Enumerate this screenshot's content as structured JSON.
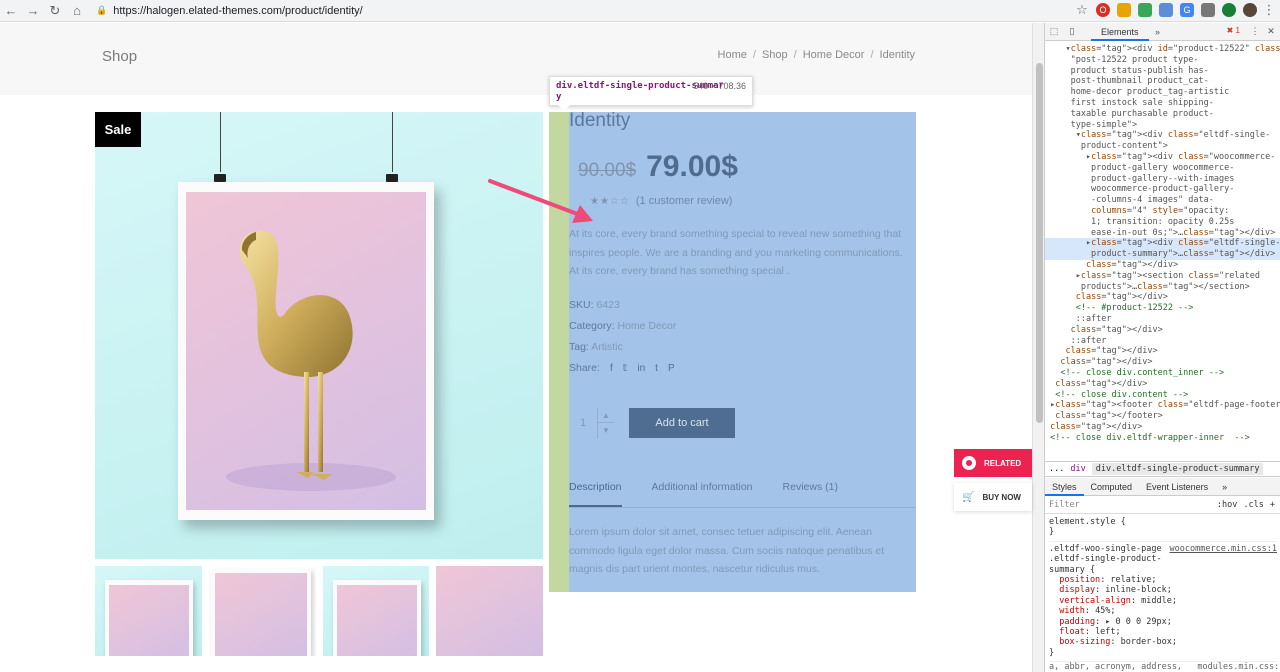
{
  "browser": {
    "url": "https://halogen.elated-themes.com/product/identity/",
    "extensions": [
      {
        "name": "opera-icon",
        "color": "#d93025"
      },
      {
        "name": "ext-yellow-icon",
        "color": "#e8a400"
      },
      {
        "name": "shield-icon",
        "color": "#3aa757"
      },
      {
        "name": "ext-blue-icon",
        "color": "#5b8dd9"
      },
      {
        "name": "translate-icon",
        "color": "#4285f4"
      },
      {
        "name": "camera-icon",
        "color": "#777777"
      },
      {
        "name": "pin-icon",
        "color": "#188038"
      }
    ]
  },
  "page": {
    "shop_title": "Shop",
    "breadcrumbs": [
      "Home",
      "Shop",
      "Home Decor",
      "Identity"
    ],
    "sale_badge": "Sale",
    "tooltip": {
      "selector": "div.eltdf-single-product-summar",
      "selector_wrap": "y",
      "size": "540 × 708.36"
    },
    "product": {
      "title": "Identity",
      "old_price": "90.00$",
      "new_price": "79.00$",
      "rating_text": "(1 customer review)",
      "description": "At its core, every brand something special to reveal new something that inspires people. We are a branding and you marketing communications. At its core, every brand has something special .",
      "sku_label": "SKU:",
      "sku": "6423",
      "category_label": "Category:",
      "category": "Home Decor",
      "tag_label": "Tag:",
      "tag": "Artistic",
      "share_label": "Share:",
      "quantity": "1",
      "add_to_cart": "Add to cart",
      "tabs": [
        "Description",
        "Additional information",
        "Reviews (1)"
      ],
      "tab_content": "Lorem ipsum dolor sit amet, consec tetuer adipiscing elit. Aenean commodo ligula eget dolor massa. Cum sociis natoque penatibus et magnis dis part urient montes, nascetur ridiculus mus."
    },
    "side_buttons": {
      "related": "RELATED",
      "buy_now": "BUY NOW"
    }
  },
  "devtools": {
    "tab": "Elements",
    "error_count": "1",
    "breadcrumbs": [
      "...",
      "div",
      "div.eltdf-single-product-summary"
    ],
    "style_tabs": [
      "Styles",
      "Computed",
      "Event Listeners"
    ],
    "filter_placeholder": "Filter",
    "filter_hov": ":hov",
    "filter_cls": ".cls",
    "element_style": "element.style {",
    "rule_selector_1": ".eltdf-woo-single-page",
    "rule_selector_2": ".eltdf-single-product-",
    "rule_selector_3": "summary {",
    "rule_source": "woocommerce.min.css:1",
    "rule_props": [
      {
        "name": "position",
        "value": "relative;"
      },
      {
        "name": "display",
        "value": "inline-block;"
      },
      {
        "name": "vertical-align",
        "value": "middle;"
      },
      {
        "name": "width",
        "value": "45%;"
      },
      {
        "name": "padding",
        "value": "▸ 0 0 0 29px;"
      },
      {
        "name": "float",
        "value": "left;"
      },
      {
        "name": "box-sizing",
        "value": "border-box;"
      }
    ],
    "bottom_line": "a, abbr, acronym, address,   modules.min.css:1",
    "dom_lines": [
      "    ▾<div id=\"product-12522\" class=",
      "     \"post-12522 product type-",
      "     product status-publish has-",
      "     post-thumbnail product_cat-",
      "     home-decor product_tag-artistic",
      "     first instock sale shipping-",
      "     taxable purchasable product-",
      "     type-simple\">",
      "      ▾<div class=\"eltdf-single-",
      "       product-content\">",
      "        ▸<div class=\"woocommerce-",
      "         product-gallery woocommerce-",
      "         product-gallery--with-images",
      "         woocommerce-product-gallery-",
      "         -columns-4 images\" data-",
      "         columns=\"4\" style=\"opacity:",
      "         1; transition: opacity 0.25s",
      "         ease-in-out 0s;\">…</div>",
      "        ▸<div class=\"eltdf-single-",
      "         product-summary\">…</div> == $0",
      "        </div>",
      "      ▸<section class=\"related",
      "       products\">…</section>",
      "      </div>",
      "      <!-- #product-12522 -->",
      "      ::after",
      "     </div>",
      "     ::after",
      "    </div>",
      "   </div>",
      "   <!-- close div.content_inner -->",
      "  </div>",
      "  <!-- close div.content -->",
      " ▸<footer class=\"eltdf-page-footer\">…",
      "  </footer>",
      " </div>",
      " <!-- close div.eltdf-wrapper-inner  -->"
    ]
  }
}
